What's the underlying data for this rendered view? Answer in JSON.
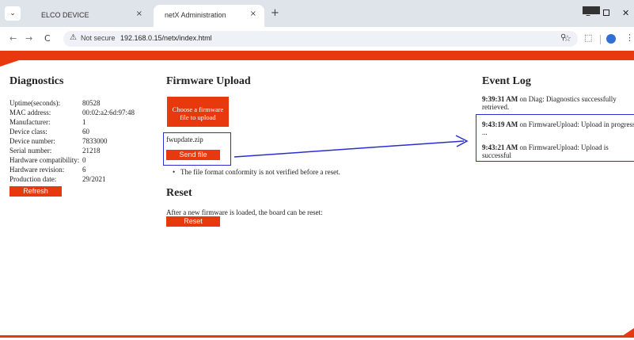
{
  "browser": {
    "tabs": [
      {
        "title": "ELCO DEVICE",
        "close": "×"
      },
      {
        "title": "netX Administration",
        "close": "×"
      }
    ],
    "new_tab": "+",
    "tab_menu": "⌄",
    "window_min": "–",
    "window_close": "✕",
    "nav_back": "←",
    "nav_forward": "→",
    "nav_reload": "C",
    "security_label": "Not secure",
    "url": "192.168.0.15/netx/index.html",
    "zoom_icon": "⚲",
    "star_icon": "☆",
    "ext_icon": "⬚",
    "menu_icon": "⋮"
  },
  "diagnostics": {
    "title": "Diagnostics",
    "rows": [
      {
        "label": "Uptime(seconds):",
        "value": "80528"
      },
      {
        "label": "MAC address:",
        "value": "00:02:a2:6d:97:48"
      },
      {
        "label": "Manufacturer:",
        "value": "1"
      },
      {
        "label": "Device class:",
        "value": "60"
      },
      {
        "label": "Device number:",
        "value": "7833000"
      },
      {
        "label": "Serial number:",
        "value": "21218"
      },
      {
        "label": "Hardware compatibility:",
        "value": "0"
      },
      {
        "label": "Hardware revision:",
        "value": "6"
      },
      {
        "label": "Production date:",
        "value": "29/2021"
      }
    ],
    "refresh_label": "Refresh"
  },
  "firmware": {
    "title": "Firmware Upload",
    "choose_label": "Choose a firmware file to upload",
    "file_name": "fwupdate.zip",
    "send_label": "Send file",
    "note": "The file format conformity is not verified before a reset."
  },
  "reset": {
    "title": "Reset",
    "text": "After a new firmware is loaded, the board can be reset:",
    "button_label": "Reset"
  },
  "event_log": {
    "title": "Event Log",
    "entries": [
      {
        "time": "9:39:31 AM",
        "line1": " on Diag: Diagnostics successfully",
        "line2": "retrieved."
      },
      {
        "time": "9:43:19 AM",
        "line1": " on FirmwareUpload: Upload in progress",
        "line2": "..."
      },
      {
        "time": "9:43:21 AM",
        "line1": " on FirmwareUpload: Upload is",
        "line2": "successful"
      }
    ]
  },
  "colors": {
    "brand": "#e8380d",
    "annotation": "#2a2ed1"
  }
}
